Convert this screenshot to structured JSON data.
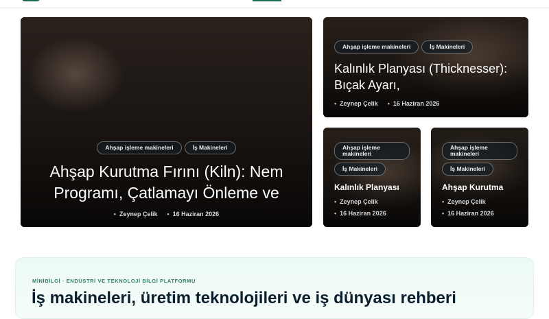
{
  "featured_main": {
    "tags": [
      "Ahşap işleme makineleri",
      "İş Makineleri"
    ],
    "title": "Ahşap Kurutma Fırını (Kiln): Nem Programı, Çatlamayı Önleme ve",
    "author": "Zeynep Çelik",
    "date": "16 Haziran 2026"
  },
  "featured_top_right": {
    "tags": [
      "Ahşap işleme makineleri",
      "İş Makineleri"
    ],
    "title": "Kalınlık Planyası (Thicknesser): Bıçak Ayarı,",
    "author": "Zeynep Çelik",
    "date": "16 Haziran 2026"
  },
  "featured_small_1": {
    "tags": [
      "Ahşap işleme makineleri",
      "İş Makineleri"
    ],
    "title": "Kalınlık Planyası",
    "author": "Zeynep Çelik",
    "date": "16 Haziran 2026"
  },
  "featured_small_2": {
    "tags": [
      "Ahşap işleme makineleri",
      "İş Makineleri"
    ],
    "title": "Ahşap Kurutma",
    "author": "Zeynep Çelik",
    "date": "16 Haziran 2026"
  },
  "banner": {
    "eyebrow": "MİNİBİLGİ · ENDÜSTRİ VE TEKNOLOJİ BİLGİ PLATFORMU",
    "headline": "İş makineleri, üretim teknolojileri ve iş dünyası rehberi"
  },
  "colors": {
    "accent": "#1f6b52",
    "headline": "#0c1f2e",
    "banner_bg": "#ecfaf5"
  }
}
